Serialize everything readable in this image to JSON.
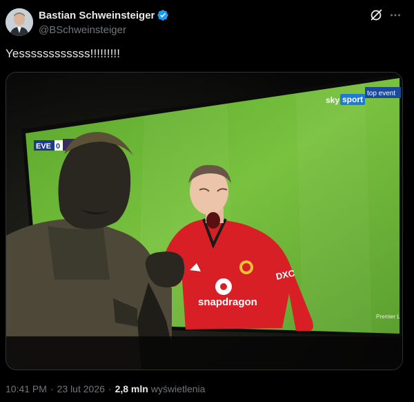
{
  "author": {
    "display_name": "Bastian Schweinsteiger",
    "handle": "@BSchweinsteiger",
    "verified": true,
    "verified_color": "#1d9bf0"
  },
  "tweet": {
    "text": "Yessssssssssss!!!!!!!!!"
  },
  "media": {
    "broadcaster_logo": "sky",
    "broadcaster_channel": "sport",
    "broadcaster_tag": "top event",
    "scoreboard_team": "EVE",
    "scoreboard_score": "0",
    "jersey_sponsor": "snapdragon",
    "sleeve_sponsor": "DXC",
    "watermark": "Premier L"
  },
  "meta": {
    "time": "10:41 PM",
    "date": "23 lut 2026",
    "views_count": "2,8 mln",
    "views_label": "wyświetlenia",
    "separator": "·"
  },
  "icons": [
    "verified-badge-icon",
    "grok-icon",
    "more-options-icon"
  ],
  "colors": {
    "background": "#000000",
    "text_primary": "#e7e9ea",
    "text_secondary": "#71767b",
    "pitch_green": "#6fb83a",
    "jersey_red": "#d81f26"
  }
}
